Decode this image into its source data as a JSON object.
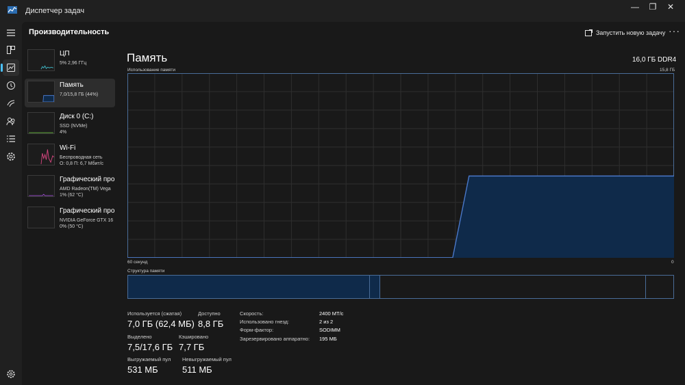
{
  "window": {
    "title": "Диспетчер задач",
    "controls": {
      "minimize": "—",
      "maximize": "❐",
      "close": "✕"
    }
  },
  "rail": {
    "items": [
      {
        "icon": "hamburger-menu-icon"
      },
      {
        "icon": "processes-icon"
      },
      {
        "icon": "performance-icon",
        "active": true
      },
      {
        "icon": "app-history-icon"
      },
      {
        "icon": "startup-apps-icon"
      },
      {
        "icon": "users-icon"
      },
      {
        "icon": "details-icon"
      },
      {
        "icon": "services-icon"
      },
      {
        "icon": "settings-icon"
      }
    ]
  },
  "header": {
    "title": "Производительность",
    "run_task_label": "Запустить новую задачу",
    "more_label": "···"
  },
  "perf_items": [
    {
      "name": "ЦП",
      "line1": "5%  2,96 ГГц",
      "line2": "",
      "color": "#3fb6c4"
    },
    {
      "name": "Память",
      "line1": "7,0/15,8 ГБ (44%)",
      "line2": "",
      "color": "#4a78c9",
      "selected": true
    },
    {
      "name": "Диск 0 (C:)",
      "line1": "SSD (NVMe)",
      "line2": "4%",
      "color": "#6cbf3f"
    },
    {
      "name": "Wi-Fi",
      "line1": "Беспроводная сеть",
      "line2": "О: 0,8  П: 6,7 Мбит/с",
      "color": "#d6457f"
    },
    {
      "name": "Графический про",
      "line1": "AMD Radeon(TM) Vega",
      "line2": "1% (62 °C)",
      "color": "#a04fd4"
    },
    {
      "name": "Графический про",
      "line1": "NVIDIA GeForce GTX 16",
      "line2": "0% (50 °C)",
      "color": "#a04fd4"
    }
  ],
  "detail": {
    "title": "Память",
    "type": "16,0 ГБ DDR4",
    "chart_label": "Использование памяти",
    "chart_max_label": "15,8 ГБ",
    "x_left_label": "60 секунд",
    "x_right_label": "0",
    "composition_label": "Структура памяти"
  },
  "chart_data": {
    "type": "area",
    "ylabel": "Использование памяти",
    "ylim": [
      0,
      15.8
    ],
    "xlim": [
      60,
      0
    ],
    "grid": true,
    "colors": {
      "line": "#4a78c9",
      "fill": "#0f2a4a"
    },
    "x": [
      60,
      24.3,
      22.5,
      0
    ],
    "values": [
      0,
      0,
      7.0,
      7.0
    ]
  },
  "composition": {
    "segments": [
      {
        "name": "in-use",
        "value_gb": 7.0,
        "fill": "#0f2a4a"
      },
      {
        "name": "modified",
        "value_gb": 0.3,
        "fill": "#0f2a4a"
      },
      {
        "name": "standby",
        "value_gb": 7.7,
        "fill": "#191919"
      },
      {
        "name": "free",
        "value_gb": 0.8,
        "fill": "#191919"
      }
    ]
  },
  "stats": {
    "in_use_label": "Используется (сжатая)",
    "in_use_value": "7,0 ГБ (62,4 МБ)",
    "available_label": "Доступно",
    "available_value": "8,8 ГБ",
    "committed_label": "Выделено",
    "committed_value": "7,5/17,6 ГБ",
    "cached_label": "Кэшировано",
    "cached_value": "7,7 ГБ",
    "paged_label": "Выгружаемый пул",
    "paged_value": "531 МБ",
    "nonpaged_label": "Невыгружаемый пул",
    "nonpaged_value": "511 МБ"
  },
  "specs": [
    {
      "label": "Скорость:",
      "value": "2400 МТ/с"
    },
    {
      "label": "Использовано гнезд:",
      "value": "2 из 2"
    },
    {
      "label": "Форм-фактор:",
      "value": "SODIMM"
    },
    {
      "label": "Зарезервировано аппаратно:",
      "value": "195 МБ"
    }
  ]
}
